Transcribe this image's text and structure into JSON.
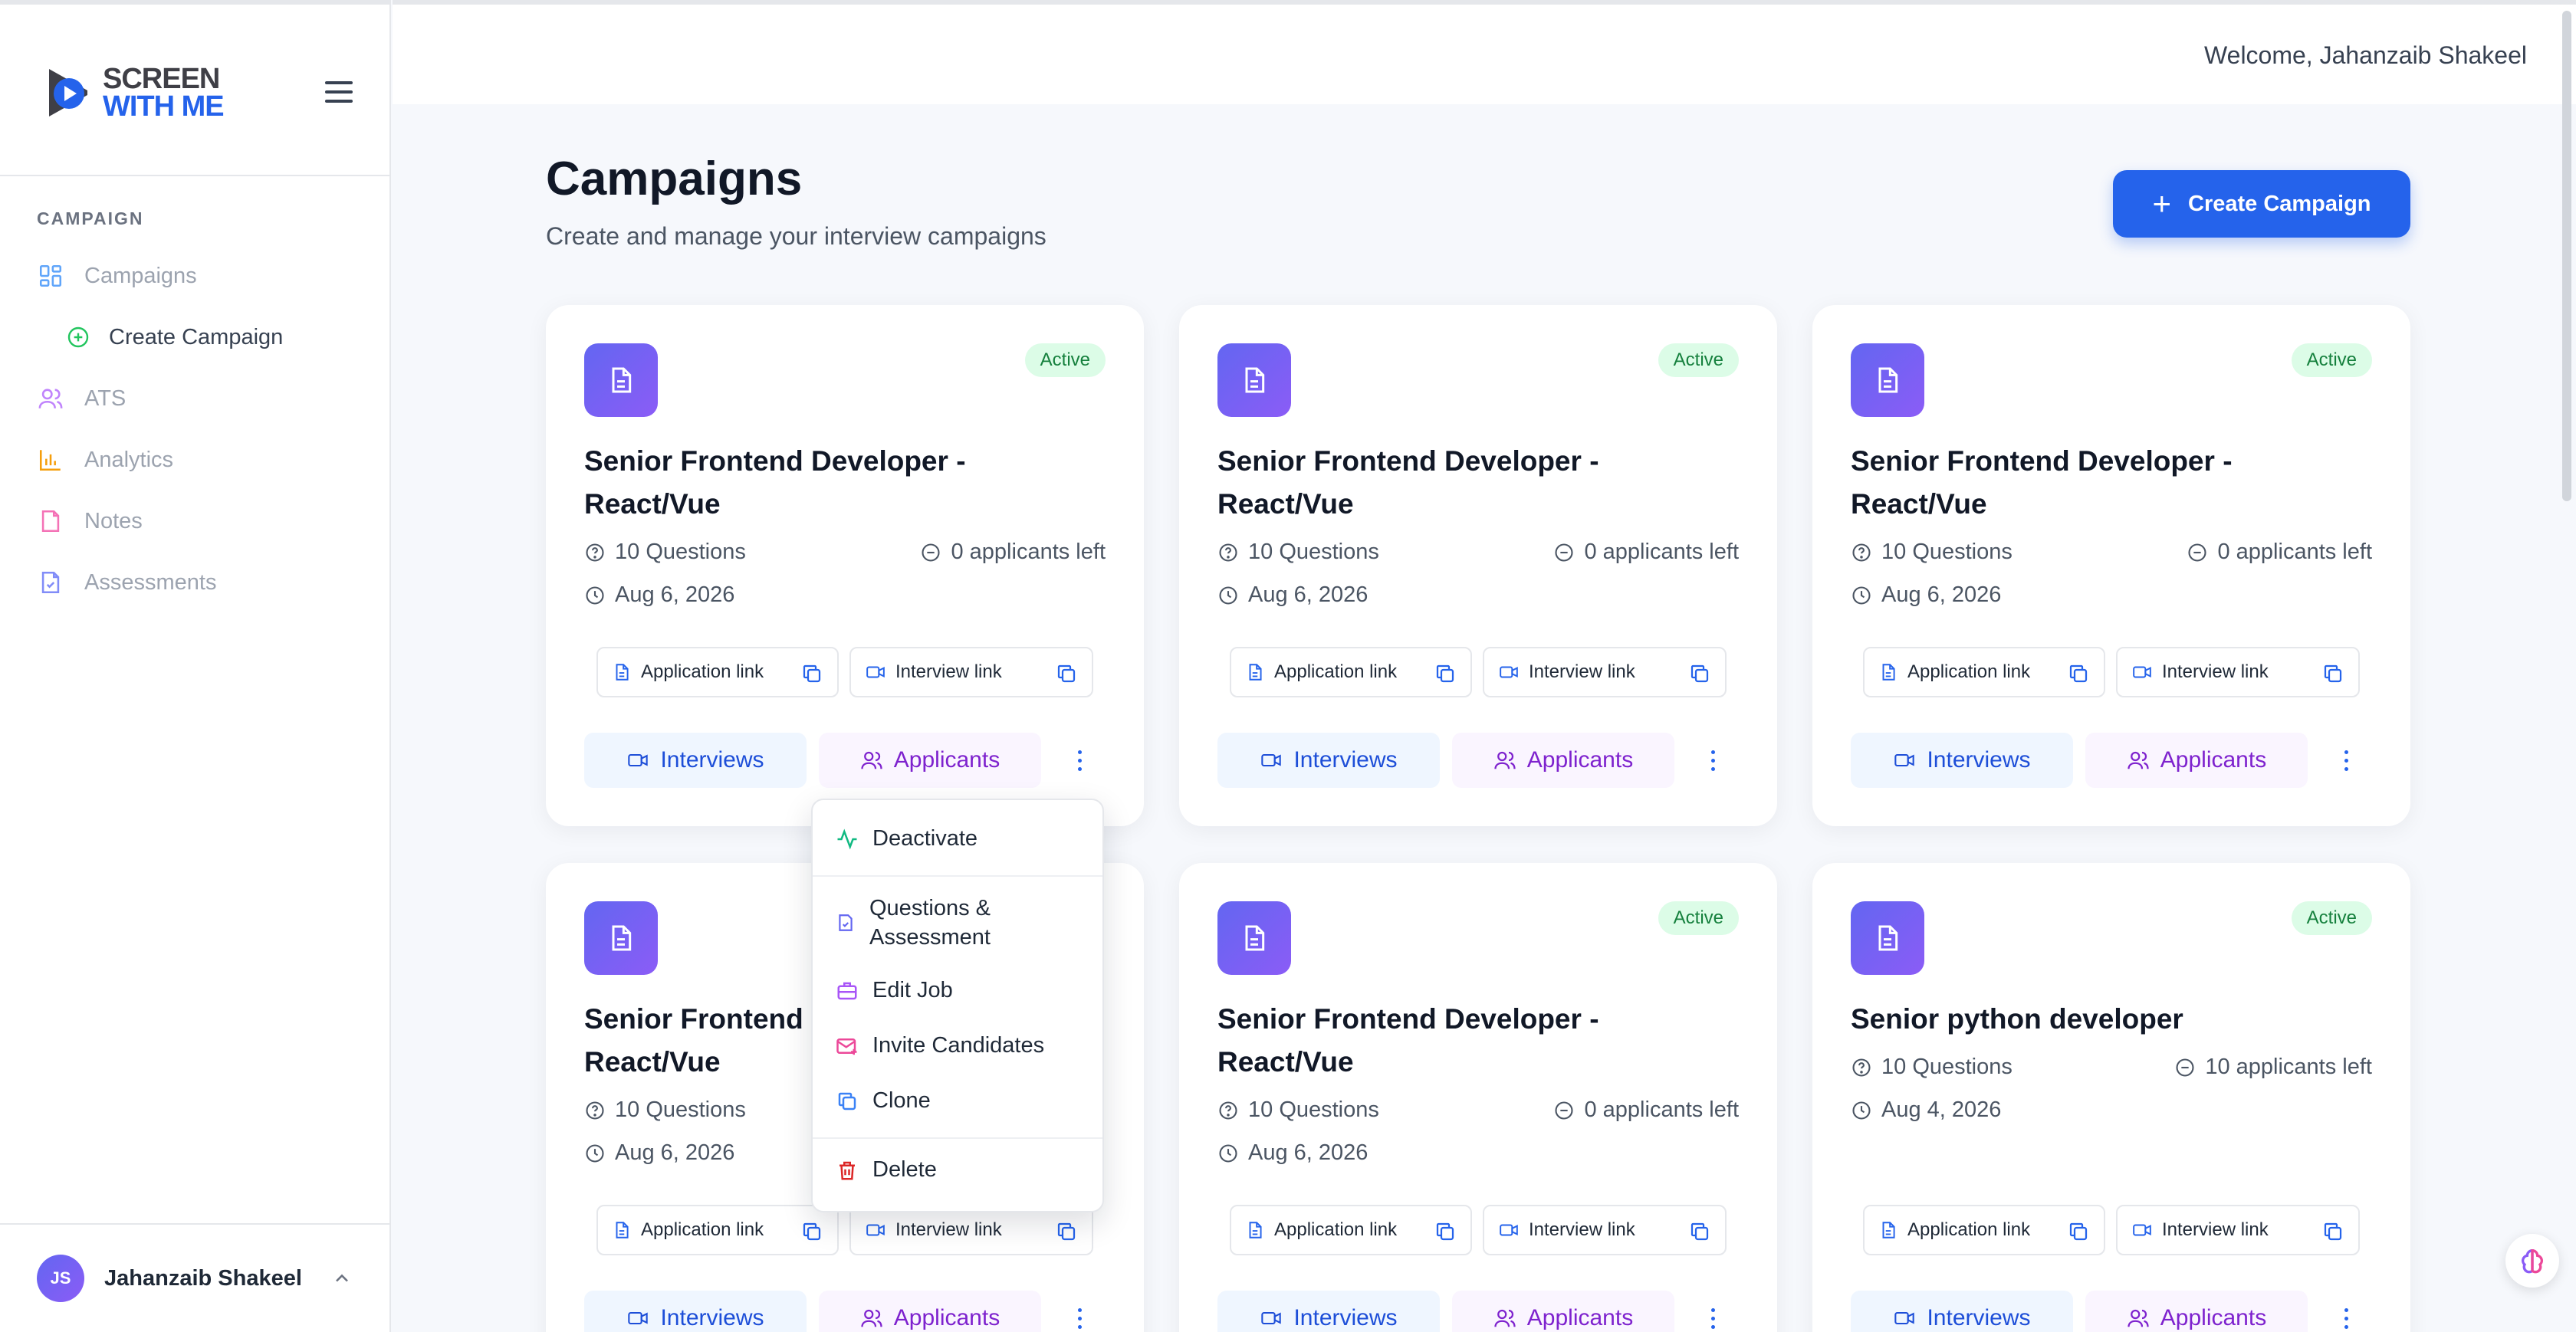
{
  "brand": {
    "line1": "SCREEN",
    "line2": "WITH ME"
  },
  "sidebar": {
    "section": "CAMPAIGN",
    "items": [
      {
        "label": "Campaigns",
        "icon": "grid-icon"
      },
      {
        "label": "Create Campaign",
        "icon": "plus-circle-icon"
      },
      {
        "label": "ATS",
        "icon": "users-icon"
      },
      {
        "label": "Analytics",
        "icon": "bar-chart-icon"
      },
      {
        "label": "Notes",
        "icon": "note-icon"
      },
      {
        "label": "Assessments",
        "icon": "file-check-icon"
      }
    ],
    "user": {
      "initials": "JS",
      "name": "Jahanzaib Shakeel"
    }
  },
  "header": {
    "welcome": "Welcome, Jahanzaib Shakeel"
  },
  "main": {
    "title": "Campaigns",
    "subtitle": "Create and manage your interview campaigns",
    "create_button": "Create Campaign"
  },
  "card_labels": {
    "application_link": "Application link",
    "interview_link": "Interview link",
    "interviews": "Interviews",
    "applicants": "Applicants"
  },
  "cards": [
    {
      "status": "Active",
      "title": "Senior Frontend Developer - React/Vue",
      "questions": "10 Questions",
      "applicants_left": "0 applicants left",
      "date": "Aug 6, 2026"
    },
    {
      "status": "Active",
      "title": "Senior Frontend Developer - React/Vue",
      "questions": "10 Questions",
      "applicants_left": "0 applicants left",
      "date": "Aug 6, 2026"
    },
    {
      "status": "Active",
      "title": "Senior Frontend Developer - React/Vue",
      "questions": "10 Questions",
      "applicants_left": "0 applicants left",
      "date": "Aug 6, 2026"
    },
    {
      "status": "",
      "title": "Senior Frontend Developer - React/Vue",
      "questions": "10 Questions",
      "applicants_left": "",
      "date": "Aug 6, 2026"
    },
    {
      "status": "Active",
      "title": "Senior Frontend Developer - React/Vue",
      "questions": "10 Questions",
      "applicants_left": "0 applicants left",
      "date": "Aug 6, 2026"
    },
    {
      "status": "Active",
      "title": "Senior python developer",
      "questions": "10 Questions",
      "applicants_left": "10 applicants left",
      "date": "Aug 4, 2026"
    }
  ],
  "menu": {
    "deactivate": "Deactivate",
    "questions_line1": "Questions &",
    "questions_line2": "Assessment",
    "edit_job": "Edit Job",
    "invite": "Invite Candidates",
    "clone": "Clone",
    "delete": "Delete"
  },
  "colors": {
    "primary": "#2563eb",
    "active_bg": "#dcfce7",
    "active_text": "#15803d",
    "applicants": "#7e22ce",
    "danger": "#dc2626"
  }
}
